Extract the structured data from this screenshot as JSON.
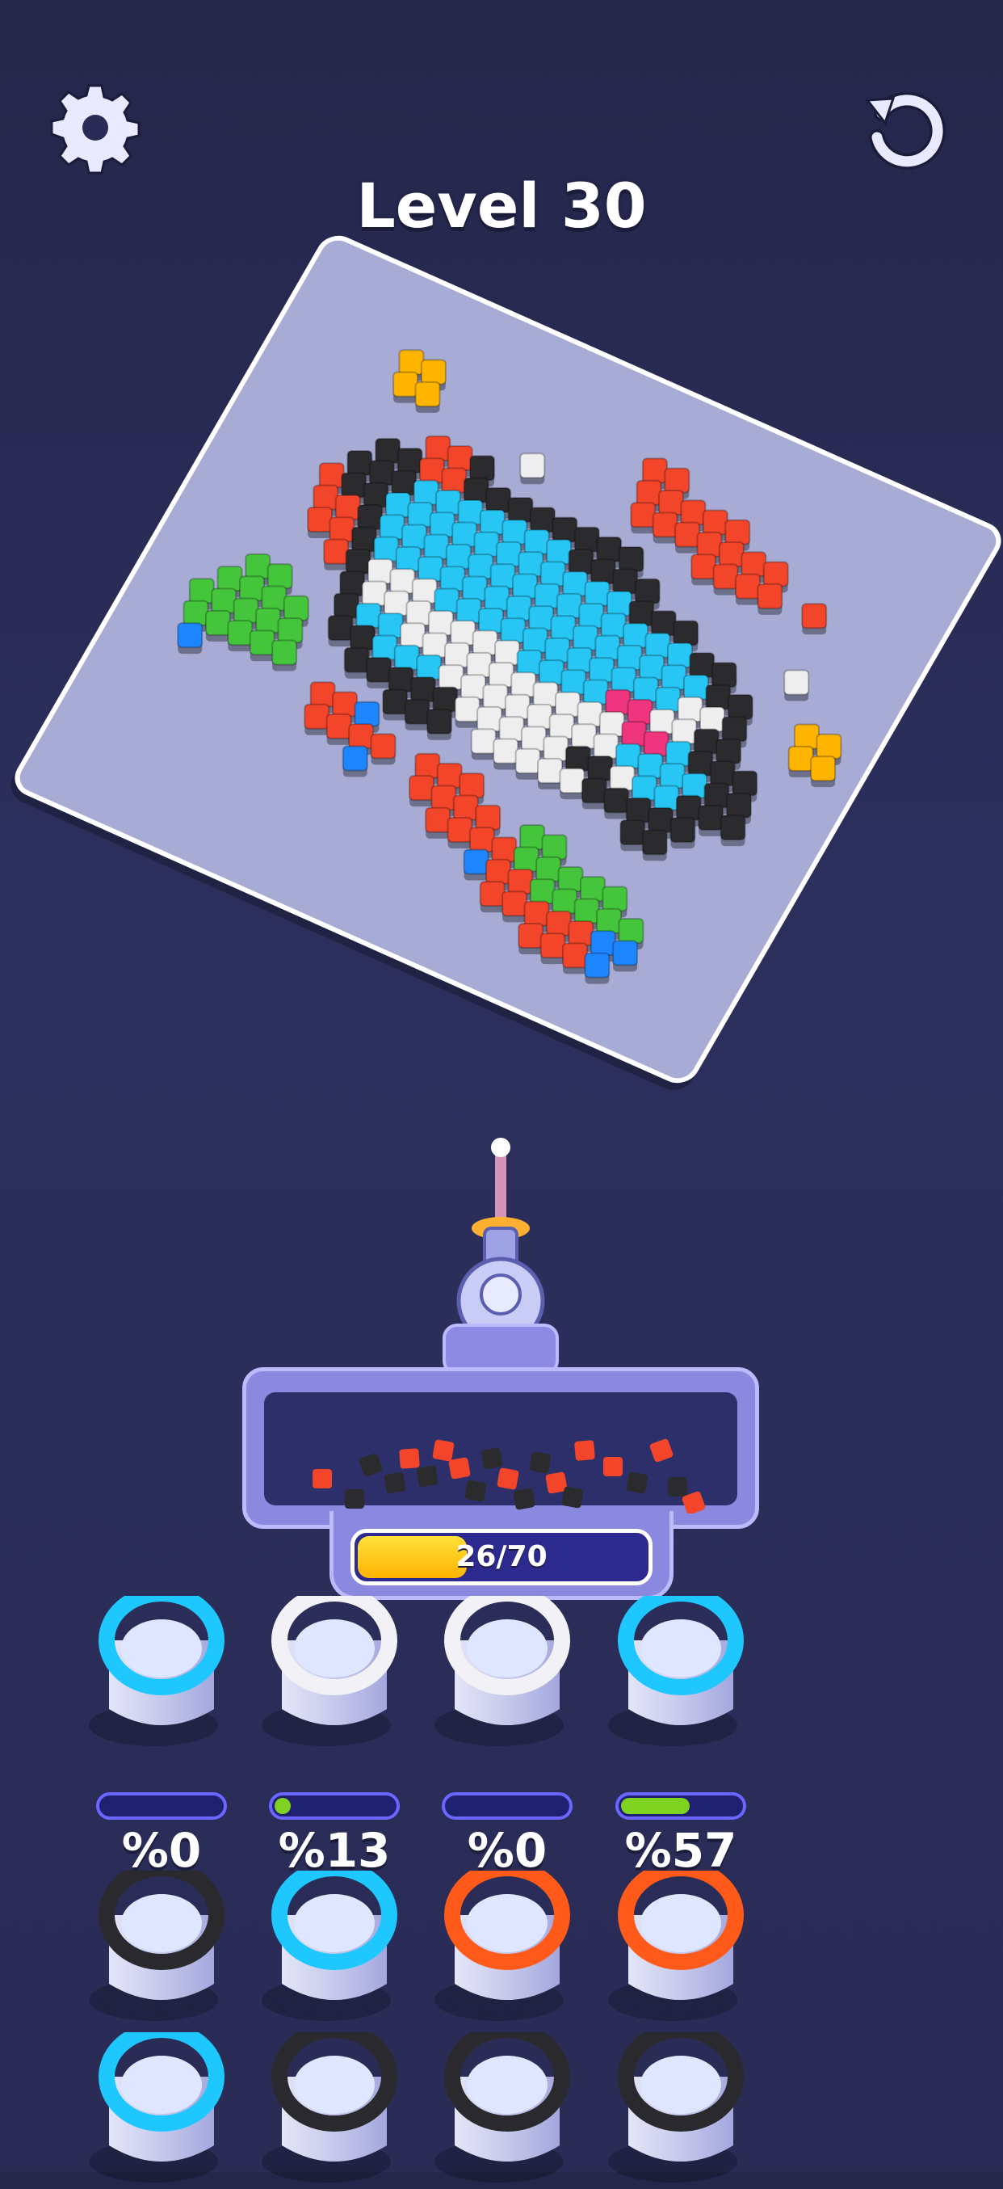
{
  "header": {
    "settings_icon": "gear-icon",
    "restart_icon": "restart-icon",
    "level_title": "Level 30"
  },
  "progress": {
    "text": "26/70",
    "current": 26,
    "total": 70
  },
  "cups": [
    {
      "color": "#1ec8ff",
      "percent_label": "%0",
      "fill": 0
    },
    {
      "color": "#f2f2f6",
      "percent_label": "%13",
      "fill": 0.13
    },
    {
      "color": "#f2f2f6",
      "percent_label": "%0",
      "fill": 0
    },
    {
      "color": "#1ec8ff",
      "percent_label": "%57",
      "fill": 0.57
    },
    {
      "color": "#2a2a2e",
      "percent_label": "",
      "fill": null
    },
    {
      "color": "#1ec8ff",
      "percent_label": "",
      "fill": null
    },
    {
      "color": "#ff5a1a",
      "percent_label": "",
      "fill": null
    },
    {
      "color": "#ff5a1a",
      "percent_label": "",
      "fill": null
    },
    {
      "color": "#1ec8ff",
      "percent_label": "",
      "fill": null
    },
    {
      "color": "#2a2a2e",
      "percent_label": "",
      "fill": null
    },
    {
      "color": "#2a2a2e",
      "percent_label": "",
      "fill": null
    },
    {
      "color": "#2a2a2e",
      "percent_label": "",
      "fill": null
    }
  ],
  "colors": {
    "cyan": "#27c6f5",
    "white": "#eeeeee",
    "black": "#2b2b2e",
    "red": "#f2452a",
    "green": "#45c53c",
    "pink": "#f0357f",
    "yellow": "#ffb400",
    "blue": "#1d86ff"
  }
}
